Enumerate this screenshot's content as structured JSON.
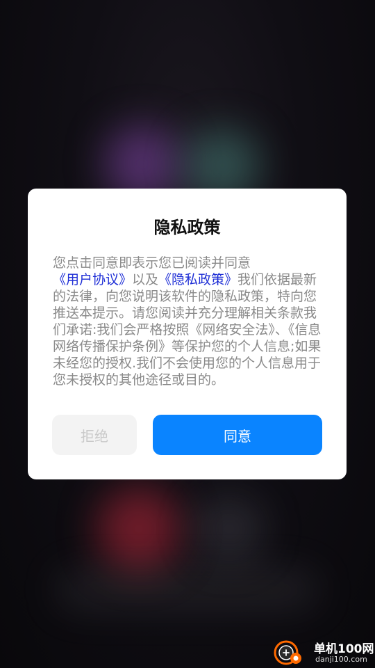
{
  "dialog": {
    "title": "隐私政策",
    "body": {
      "text_1": "您点击同意即表示您已阅读并同意",
      "link_user_agreement": "《用户协议》",
      "text_2": "以及",
      "link_privacy_policy": "《隐私政策》",
      "text_3": "我们依据最新的法律，向您说明该软件的隐私政策，特向您推送本提示。请您阅读并充分理解相关条款我们承诺:我们会严格按照《网络安全法》、《信息网络传播保护条例》等保护您的个人信息;如果未经您的授权.我们不会使用您的个人信息用于您未授权的其他途径或目的。"
    },
    "reject_label": "拒绝",
    "agree_label": "同意"
  },
  "watermark": {
    "name": "单机100网",
    "domain": "danji100.com"
  },
  "colors": {
    "accent": "#0a84ff",
    "link": "#1f2fd6",
    "body_text": "#8a8a8a",
    "watermark_orange": "#ff6a00"
  }
}
